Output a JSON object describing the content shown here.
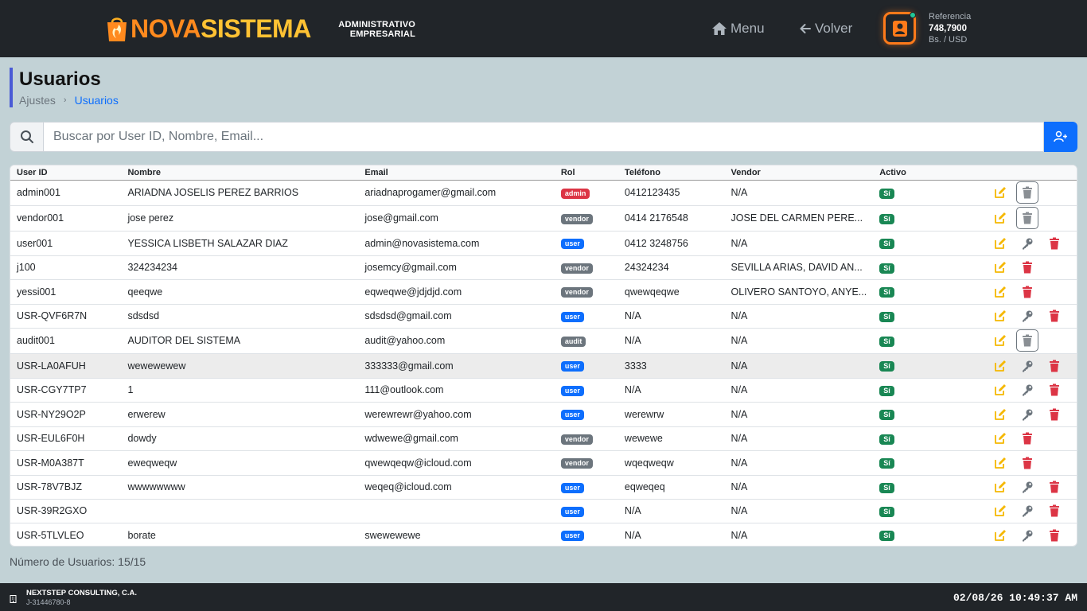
{
  "header": {
    "logo_part1": "NOVA",
    "logo_part2": "SISTEMA",
    "subtitle_line1": "ADMINISTRATIVO",
    "subtitle_line2": "EMPRESARIAL",
    "menu_label": "Menu",
    "back_label": "Volver",
    "ref_label": "Referencia",
    "ref_value": "748,7900",
    "ref_unit": "Bs. / USD"
  },
  "page": {
    "title": "Usuarios",
    "breadcrumb": [
      "Ajustes",
      "Usuarios"
    ]
  },
  "search": {
    "placeholder": "Buscar por User ID, Nombre, Email..."
  },
  "table": {
    "columns": [
      "User ID",
      "Nombre",
      "Email",
      "Rol",
      "Teléfono",
      "Vendor",
      "Activo"
    ],
    "rows": [
      {
        "id": "admin001",
        "name": "ARIADNA JOSELIS PEREZ BARRIOS",
        "email": "ariadnaprogamer@gmail.com",
        "role": "admin",
        "phone": "0412123435",
        "vendor": "N/A",
        "active": "Sí",
        "actions": [
          "edit",
          "trash-disabled"
        ]
      },
      {
        "id": "vendor001",
        "name": "jose perez",
        "email": "jose@gmail.com",
        "role": "vendor",
        "phone": "0414 2176548",
        "vendor": "JOSE DEL CARMEN PERE...",
        "active": "Sí",
        "actions": [
          "edit",
          "trash-disabled"
        ]
      },
      {
        "id": "user001",
        "name": "YESSICA LISBETH SALAZAR DIAZ",
        "email": "admin@novasistema.com",
        "role": "user",
        "phone": "0412 3248756",
        "vendor": "N/A",
        "active": "Sí",
        "actions": [
          "edit",
          "key",
          "delete"
        ]
      },
      {
        "id": "j100",
        "name": "324234234",
        "email": "josemcy@gmail.com",
        "role": "vendor",
        "phone": "24324234",
        "vendor": "SEVILLA ARIAS, DAVID AN...",
        "active": "Sí",
        "actions": [
          "edit",
          "delete"
        ]
      },
      {
        "id": "yessi001",
        "name": "qeeqwe",
        "email": "eqweqwe@jdjdjd.com",
        "role": "vendor",
        "phone": "qwewqeqwe",
        "vendor": "OLIVERO SANTOYO, ANYE...",
        "active": "Sí",
        "actions": [
          "edit",
          "delete"
        ]
      },
      {
        "id": "USR-QVF6R7N",
        "name": "sdsdsd",
        "email": "sdsdsd@gmail.com",
        "role": "user",
        "phone": "N/A",
        "vendor": "N/A",
        "active": "Sí",
        "actions": [
          "edit",
          "key",
          "delete"
        ]
      },
      {
        "id": "audit001",
        "name": "AUDITOR DEL SISTEMA",
        "email": "audit@yahoo.com",
        "role": "audit",
        "phone": "N/A",
        "vendor": "N/A",
        "active": "Sí",
        "actions": [
          "edit",
          "trash-disabled"
        ]
      },
      {
        "id": "USR-LA0AFUH",
        "name": "wewewewew",
        "email": "333333@gmail.com",
        "role": "user",
        "phone": "3333",
        "vendor": "N/A",
        "active": "Sí",
        "actions": [
          "edit",
          "key",
          "delete"
        ]
      },
      {
        "id": "USR-CGY7TP7",
        "name": "1",
        "email": "111@outlook.com",
        "role": "user",
        "phone": "N/A",
        "vendor": "N/A",
        "active": "Sí",
        "actions": [
          "edit",
          "key",
          "delete"
        ]
      },
      {
        "id": "USR-NY29O2P",
        "name": "erwerew",
        "email": "werewrewr@yahoo.com",
        "role": "user",
        "phone": "werewrw",
        "vendor": "N/A",
        "active": "Sí",
        "actions": [
          "edit",
          "key",
          "delete"
        ]
      },
      {
        "id": "USR-EUL6F0H",
        "name": "dowdy",
        "email": "wdwewe@gmail.com",
        "role": "vendor",
        "phone": "wewewe",
        "vendor": "N/A",
        "active": "Sí",
        "actions": [
          "edit",
          "delete"
        ]
      },
      {
        "id": "USR-M0A387T",
        "name": "eweqweqw",
        "email": "qwewqeqw@icloud.com",
        "role": "vendor",
        "phone": "wqeqweqw",
        "vendor": "N/A",
        "active": "Sí",
        "actions": [
          "edit",
          "delete"
        ]
      },
      {
        "id": "USR-78V7BJZ",
        "name": "wwwwwwww",
        "email": "weqeq@icloud.com",
        "role": "user",
        "phone": "eqweqeq",
        "vendor": "N/A",
        "active": "Sí",
        "actions": [
          "edit",
          "key",
          "delete"
        ]
      },
      {
        "id": "USR-39R2GXO",
        "name": "",
        "email": "",
        "role": "user",
        "phone": "N/A",
        "vendor": "N/A",
        "active": "Sí",
        "actions": [
          "edit",
          "key",
          "delete"
        ]
      },
      {
        "id": "USR-5TLVLEO",
        "name": "borate",
        "email": "swewewewe",
        "role": "user",
        "phone": "N/A",
        "vendor": "N/A",
        "active": "Sí",
        "actions": [
          "edit",
          "key",
          "delete"
        ]
      }
    ],
    "highlighted_row": 7
  },
  "summary": {
    "count_text": "Número de Usuarios: 15/15"
  },
  "footer": {
    "company": "NEXTSTEP CONSULTING, C.A.",
    "rif": "J-31446780-8",
    "datetime": "02/08/26 10:49:37 AM"
  },
  "colors": {
    "accent_orange": "#ff7a1a",
    "primary_blue": "#0d6efd",
    "admin_red": "#dc3545",
    "role_gray": "#6c757d",
    "active_green": "#198754",
    "edit_yellow": "#f5b800"
  },
  "icons": {
    "edit": "pencil-square-icon",
    "key": "key-icon",
    "delete": "trash-icon",
    "trash-disabled": "trash-icon"
  }
}
